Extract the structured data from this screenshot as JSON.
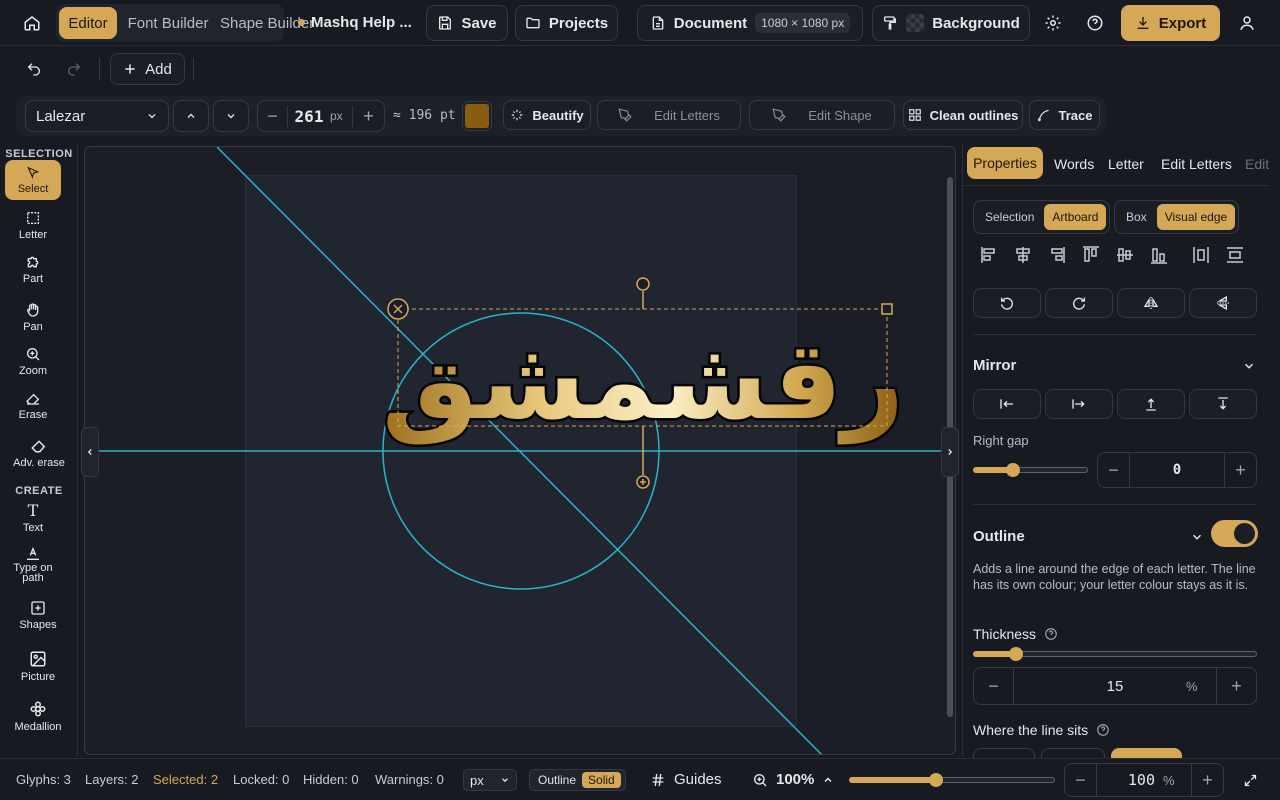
{
  "topbar": {
    "tabs": [
      "Editor",
      "Font Builder",
      "Shape Builder"
    ],
    "help_title": "Mashq Help ...",
    "save_label": "Save",
    "projects_label": "Projects",
    "document_label": "Document",
    "document_size": "1080 × 1080 px",
    "background_label": "Background",
    "export_label": "Export"
  },
  "toolbar2": {
    "add_label": "Add"
  },
  "fontbar": {
    "font_name": "Lalezar",
    "size_value": "261",
    "size_unit": "px",
    "pt_equiv": "≈ 196 pt",
    "color": "#8a5c12",
    "beautify": "Beautify",
    "edit_letters": "Edit Letters",
    "edit_shape": "Edit Shape",
    "clean_outlines": "Clean outlines",
    "trace": "Trace"
  },
  "left_tools": {
    "selection_label": "SELECTION",
    "create_label": "CREATE",
    "items": [
      "Select",
      "Letter",
      "Part",
      "Pan",
      "Zoom",
      "Erase",
      "Adv. erase",
      "Text",
      "Type on path",
      "Shapes",
      "Picture",
      "Medallion"
    ]
  },
  "canvas": {
    "text": "رقشمشق"
  },
  "panel": {
    "tabs": [
      "Properties",
      "Words",
      "Letter",
      "Edit Letters",
      "Edit"
    ],
    "align_to": [
      "Selection",
      "Artboard"
    ],
    "bounds": [
      "Box",
      "Visual edge"
    ],
    "mirror_title": "Mirror",
    "right_gap_label": "Right gap",
    "right_gap_value": "0",
    "right_gap_level": 0.35,
    "outline_title": "Outline",
    "outline_desc": "Adds a line around the edge of each letter. The line has its own colour; your letter colour stays as it is.",
    "thickness_label": "Thickness",
    "thickness_value": "15",
    "thickness_unit": "%",
    "thickness_level": 0.15,
    "where_label": "Where the line sits"
  },
  "status": {
    "glyphs": "Glyphs: 3",
    "layers": "Layers: 2",
    "selected": "Selected: 2",
    "locked": "Locked: 0",
    "hidden": "Hidden: 0",
    "warnings": "Warnings: 0",
    "unit": "px",
    "outline": "Outline",
    "solid": "Solid",
    "guides": "Guides",
    "zoom": "100%",
    "zoom_value": "100",
    "zoom_unit": "%",
    "zoom_level": 0.42
  },
  "colors": {
    "accent": "#d4a857",
    "guide": "#2bb3c9",
    "bg": "#171a21"
  }
}
